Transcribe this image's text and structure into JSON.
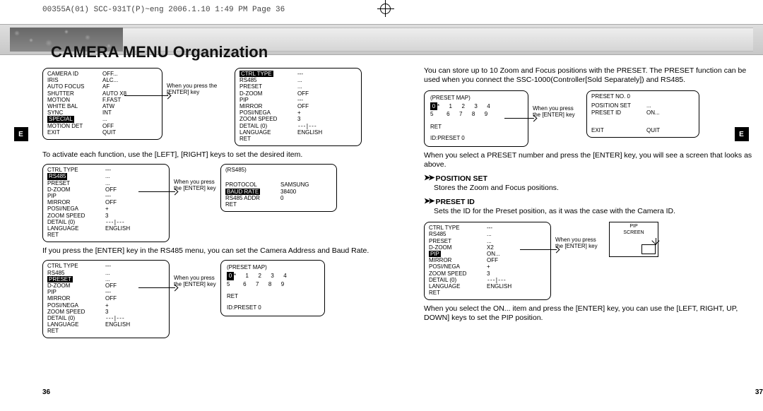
{
  "slug": "00355A(01) SCC-931T(P)~eng  2006.1.10  1:49 PM  Page 36",
  "banner_title": "CAMERA MENU Organization",
  "side_tab": "E",
  "page_numbers": {
    "left": "36",
    "right": "37"
  },
  "menus": {
    "main": {
      "camera_id": {
        "label": "CAMERA ID",
        "val": "OFF..."
      },
      "iris": {
        "label": "IRIS",
        "val": "ALC..."
      },
      "auto_focus": {
        "label": "AUTO FOCUS",
        "val": "AF"
      },
      "shutter": {
        "label": "SHUTTER",
        "val": "AUTO X8"
      },
      "motion": {
        "label": "MOTION",
        "val": "F.FAST"
      },
      "white_bal": {
        "label": "WHITE BAL",
        "val": "ATW"
      },
      "sync": {
        "label": "SYNC",
        "val": "INT"
      },
      "special": {
        "label": "SPECIAL",
        "val": "..."
      },
      "motion_det": {
        "label": "MOTION DET",
        "val": "OFF"
      },
      "exit": {
        "label": "EXIT",
        "val": "QUIT"
      }
    },
    "special": {
      "title": "CTRL TYPE",
      "ctrl_type": {
        "label": "CTRL TYPE",
        "val": "---"
      },
      "rs485": {
        "label": "RS485",
        "val": "..."
      },
      "preset": {
        "label": "PRESET",
        "val": "..."
      },
      "d_zoom": {
        "label": "D-ZOOM",
        "val": "OFF"
      },
      "pip": {
        "label": "PIP",
        "val": "---"
      },
      "mirror": {
        "label": "MIRROR",
        "val": "OFF"
      },
      "posi_nega": {
        "label": "POSI/NEGA",
        "val": "+"
      },
      "zoom_speed": {
        "label": "ZOOM SPEED",
        "val": "3"
      },
      "detail": {
        "label": "DETAIL (0)",
        "val": "---|---"
      },
      "language": {
        "label": "LANGUAGE",
        "val": "ENGLISH"
      },
      "ret": {
        "label": "RET",
        "val": ""
      }
    },
    "rs485_panel": {
      "title": "(RS485)",
      "protocol": {
        "label": "PROTOCOL",
        "val": "SAMSUNG"
      },
      "baud_rate": {
        "label": "BAUD RATE",
        "val": "38400"
      },
      "addr": {
        "label": "RS485 ADDR",
        "val": "0"
      },
      "ret": {
        "label": "RET",
        "val": ""
      }
    },
    "preset_map": {
      "title": "(PRESET MAP)",
      "nums_row1": "0* 1 2 3 4",
      "nums_row2": "5  6 7 8 9",
      "ret": "RET",
      "id": "ID:PRESET 0"
    },
    "preset_no": {
      "title": "PRESET NO. 0",
      "position_set": {
        "label": "POSITION SET",
        "val": "..."
      },
      "preset_id": {
        "label": "PRESET ID",
        "val": "ON..."
      },
      "exit": {
        "label": "EXIT",
        "val": "QUIT"
      }
    },
    "pip_menu": {
      "d_zoom": {
        "label": "D-ZOOM",
        "val": "X2"
      },
      "pip": {
        "label": "PIP",
        "val": "ON..."
      },
      "mirror": {
        "label": "MIRROR",
        "val": "OFF"
      }
    },
    "pip_screen": {
      "label": "PIP",
      "sublabel": "SCREEN"
    }
  },
  "text": {
    "arrow_note": "When you press the [ENTER] key",
    "left": {
      "para1": "To activate each function, use the [LEFT], [RIGHT] keys to set the desired item.",
      "para2": "If you press the [ENTER] key in the RS485 menu, you can set the Camera Address and Baud Rate."
    },
    "right": {
      "intro": "You can store up to 10 Zoom and Focus positions with the PRESET. The PRESET function can be used when you connect the SSC-1000(Controller[Sold Separately]) and RS485.",
      "after_map": "When you select a PRESET number and press the [ENTER] key, you will see a screen that looks as above.",
      "position_set": {
        "title": "POSITION SET",
        "body": "Stores the Zoom and Focus positions."
      },
      "preset_id": {
        "title": "PRESET ID",
        "body": "Sets the ID for the Preset position, as it was the case with the Camera ID."
      },
      "pip_note": "When you select the ON... item and press the [ENTER] key, you can use the [LEFT, RIGHT, UP, DOWN] keys to set the PIP position."
    },
    "sel_zero": "0",
    "bullet_mark": "➤➤"
  }
}
